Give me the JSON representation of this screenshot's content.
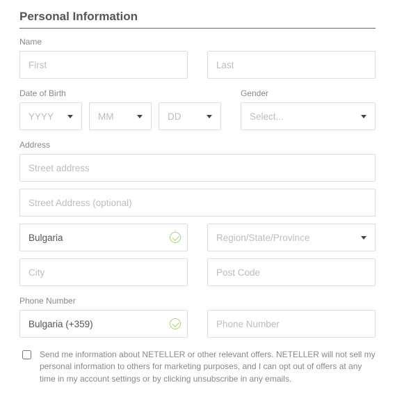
{
  "section_title": "Personal Information",
  "labels": {
    "name": "Name",
    "dob": "Date of Birth",
    "gender": "Gender",
    "address": "Address",
    "phone": "Phone Number"
  },
  "placeholders": {
    "first": "First",
    "last": "Last",
    "yyyy": "YYYY",
    "mm": "MM",
    "dd": "DD",
    "gender": "Select...",
    "street": "Street address",
    "street2": "Street Address (optional)",
    "region": "Region/State/Province",
    "city": "City",
    "postcode": "Post Code",
    "phone": "Phone Number"
  },
  "values": {
    "country": "Bulgaria",
    "phone_country": "Bulgaria (+359)"
  },
  "consent_text": "Send me information about NETELLER or other relevant offers. NETELLER will not sell my personal information to others for marketing purposes, and I can opt out of offers at any time in my account settings or by clicking unsubscribe in any emails."
}
